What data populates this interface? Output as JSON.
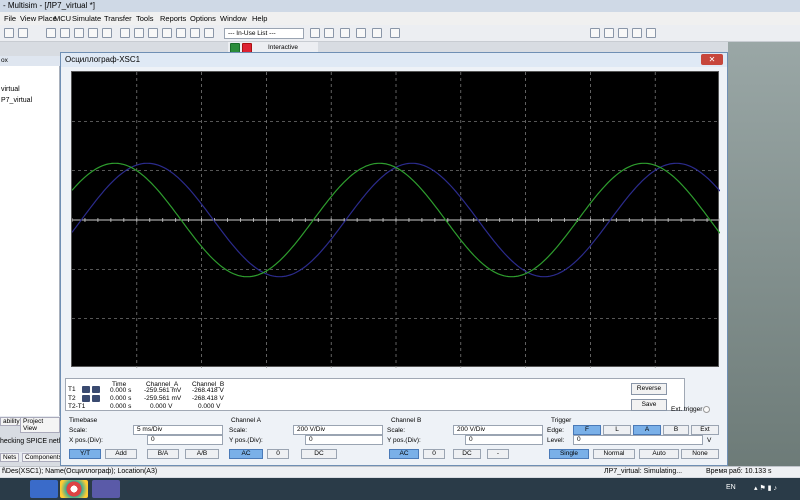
{
  "app": {
    "title": "- Multisim - [ЛР7_virtual *]"
  },
  "menu": [
    "File",
    "View",
    "Place",
    "MCU",
    "Simulate",
    "Transfer",
    "Tools",
    "Reports",
    "Options",
    "Window",
    "Help"
  ],
  "toolbar": {
    "combo": "--- In-Use List ---",
    "interactive": "Interactive"
  },
  "left_panel": {
    "header": "ox",
    "items": [
      "virtual",
      "P7_virtual"
    ],
    "tabs": [
      "ability",
      "Project View"
    ]
  },
  "status": {
    "message": "hecking SPICE netlist f",
    "bottom_tabs": [
      "Nets",
      "Components"
    ],
    "bar_left": "f\\Des(XSC1); Name(Осциллограф); Location(A3)",
    "bar_mid": "ЛР7_virtual: Simulating...",
    "bar_right": "Время раб: 10.133 s"
  },
  "taskbar": {
    "lang": "EN",
    "time": ""
  },
  "scope": {
    "title": "Осциллограф-XSC1",
    "close": "✕",
    "readout": {
      "headers": [
        "Time",
        "Channel_A",
        "Channel_B"
      ],
      "rows": [
        {
          "label": "T1",
          "time": "0.000 s",
          "a": "-259.561 mV",
          "b": "-268.418 V"
        },
        {
          "label": "T2",
          "time": "0.000 s",
          "a": "-259.561 mV",
          "b": "-268.418 V"
        },
        {
          "label": "T2-T1",
          "time": "0.000 s",
          "a": "0.000 V",
          "b": "0.000 V"
        }
      ]
    },
    "reverse": "Reverse",
    "save": "Save",
    "ext_trigger": "Ext. trigger",
    "timebase": {
      "title": "Timebase",
      "scale_label": "Scale:",
      "scale": "5 ms/Div",
      "pos_label": "X pos.(Div):",
      "pos": "0",
      "buttons": [
        "Y/T",
        "Add",
        "B/A",
        "A/B"
      ]
    },
    "channel_a": {
      "title": "Channel A",
      "scale_label": "Scale:",
      "scale": "200 V/Div",
      "pos_label": "Y pos.(Div):",
      "pos": "0",
      "buttons": [
        "AC",
        "0",
        "DC"
      ]
    },
    "channel_b": {
      "title": "Channel B",
      "scale_label": "Scale:",
      "scale": "200 V/Div",
      "pos_label": "Y pos.(Div):",
      "pos": "0",
      "buttons": [
        "AC",
        "0",
        "DC",
        "-"
      ]
    },
    "trigger": {
      "title": "Trigger",
      "edge_label": "Edge:",
      "edge_buttons": [
        "F",
        "L",
        "A",
        "B",
        "Ext"
      ],
      "level_label": "Level:",
      "level": "0",
      "level_unit": "V",
      "mode_buttons": [
        "Single",
        "Normal",
        "Auto",
        "None"
      ]
    },
    "colors": {
      "screen": "#000000",
      "grid": "#8a8a8a",
      "trace_a": "#2e9d2e",
      "trace_b": "#2b2b8c"
    }
  }
}
